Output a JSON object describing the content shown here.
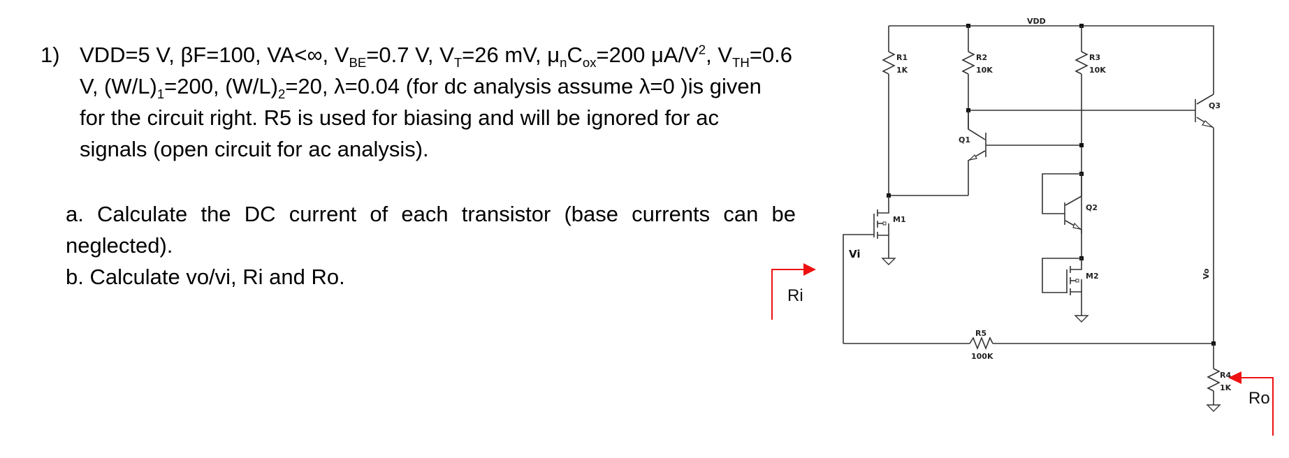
{
  "problem": {
    "number": "1)",
    "lines": [
      [
        "VDD=5 V, ",
        "βF=100, VA<∞, V",
        "BE",
        "=0.7 V, V",
        "T",
        "=26 mV, μ",
        "n",
        "C",
        "ox",
        "=200 μA/V",
        "2",
        ", V",
        "TH",
        "=0.6"
      ],
      "V, (W/L)₁=200, (W/L)₂=20, λ=0.04 (for dc analysis assume λ=0 )is given",
      "for the circuit right. R5 is used for biasing and will be ignored for ac",
      "signals (open circuit for ac analysis)."
    ],
    "line1": {
      "t1": "VDD=5 V, βF=100, VA<∞, V",
      "s1": "BE",
      "t2": "=0.7 V, V",
      "s2": "T",
      "t3": "=26 mV, μ",
      "s3": "n",
      "t4": "C",
      "s4": "ox",
      "t5": "=200 μA/V",
      "p5": "2",
      "t6": ", V",
      "s6": "TH",
      "t7": "=0.6"
    },
    "line2": {
      "t1": "V, (W/L)",
      "s1": "1",
      "t2": "=200, (W/L)",
      "s2": "2",
      "t3": "=20, λ=0.04 (for dc analysis assume λ=0 )is given"
    },
    "line3": "for the circuit right. R5 is used for biasing and will be ignored for ac",
    "line4": "signals (open circuit for ac analysis)."
  },
  "tasks": {
    "a_line1": "a. Calculate the DC current of each transistor (base currents can be",
    "a_line2": "neglected).",
    "b": "b. Calculate vo/vi, Ri and Ro."
  },
  "schematic": {
    "supply_label": "VDD",
    "components": {
      "R1": {
        "name": "R1",
        "value": "1K"
      },
      "R2": {
        "name": "R2",
        "value": "10K"
      },
      "R3": {
        "name": "R3",
        "value": "10K"
      },
      "R4": {
        "name": "R4",
        "value": "1K"
      },
      "R5": {
        "name": "R5",
        "value": "100K"
      },
      "Q1": {
        "name": "Q1"
      },
      "Q2": {
        "name": "Q2"
      },
      "Q3": {
        "name": "Q3"
      },
      "M1": {
        "name": "M1"
      },
      "M2": {
        "name": "M2"
      }
    },
    "nodes": {
      "input": "Vi",
      "output": "Vo"
    },
    "annotations": {
      "input_resistance": "Ri",
      "output_resistance": "Ro",
      "arrow_color": "#ee1111"
    }
  }
}
